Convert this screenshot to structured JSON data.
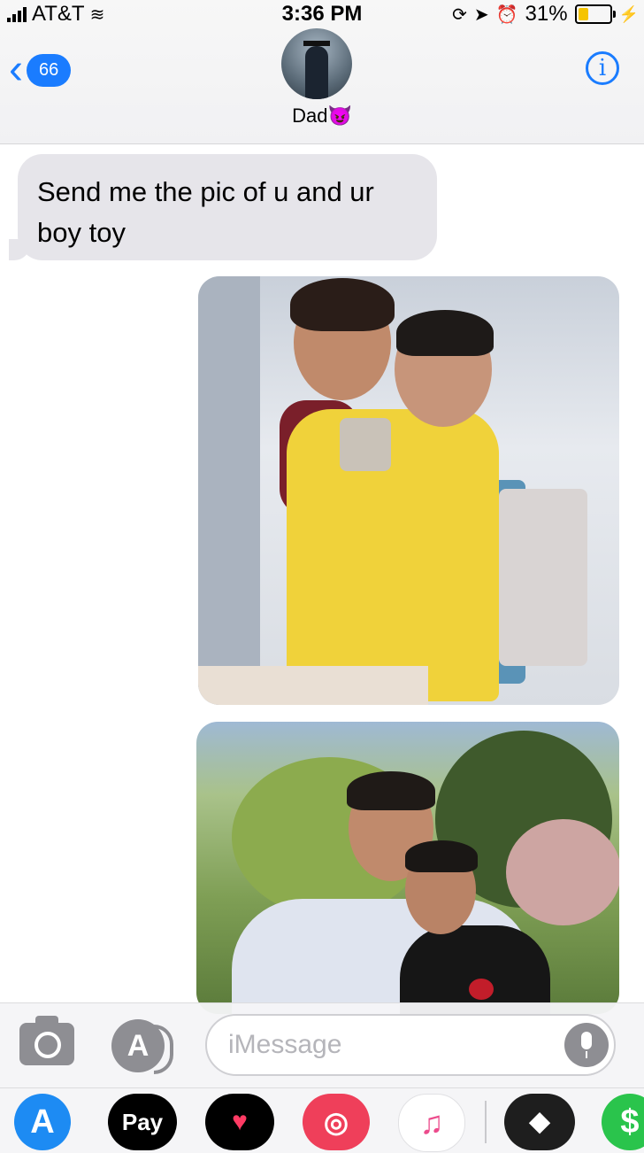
{
  "status_bar": {
    "carrier": "AT&T",
    "time": "3:36 PM",
    "battery_percent": "31%",
    "battery_level": 0.31
  },
  "nav": {
    "back_count": "66",
    "contact_name": "Dad",
    "contact_emoji": "😈",
    "info_icon_label": "i"
  },
  "messages": [
    {
      "type": "text",
      "direction": "incoming",
      "text": "Send me the pic of u and ur boy toy"
    },
    {
      "type": "photo",
      "direction": "outgoing"
    },
    {
      "type": "photo",
      "direction": "outgoing"
    }
  ],
  "compose": {
    "placeholder": "iMessage"
  },
  "app_drawer": {
    "apps": [
      {
        "name": "App Store",
        "icon": "app-store-icon",
        "glyph": "A"
      },
      {
        "name": "Apple Pay",
        "icon": "apple-pay-icon",
        "glyph": "Pay"
      },
      {
        "name": "Digital Touch",
        "icon": "heart-icon",
        "glyph": "♥"
      },
      {
        "name": "Images",
        "icon": "globe-search-icon",
        "glyph": "◎"
      },
      {
        "name": "Music",
        "icon": "music-icon",
        "glyph": "♫"
      },
      {
        "name": "Game Pigeon",
        "icon": "game-controller-icon",
        "glyph": "◆"
      },
      {
        "name": "Cash",
        "icon": "cash-icon",
        "glyph": "$"
      }
    ]
  },
  "colors": {
    "accent": "#1a7cff",
    "incoming_bubble": "#e6e5ea",
    "battery_fill": "#f5c400"
  }
}
